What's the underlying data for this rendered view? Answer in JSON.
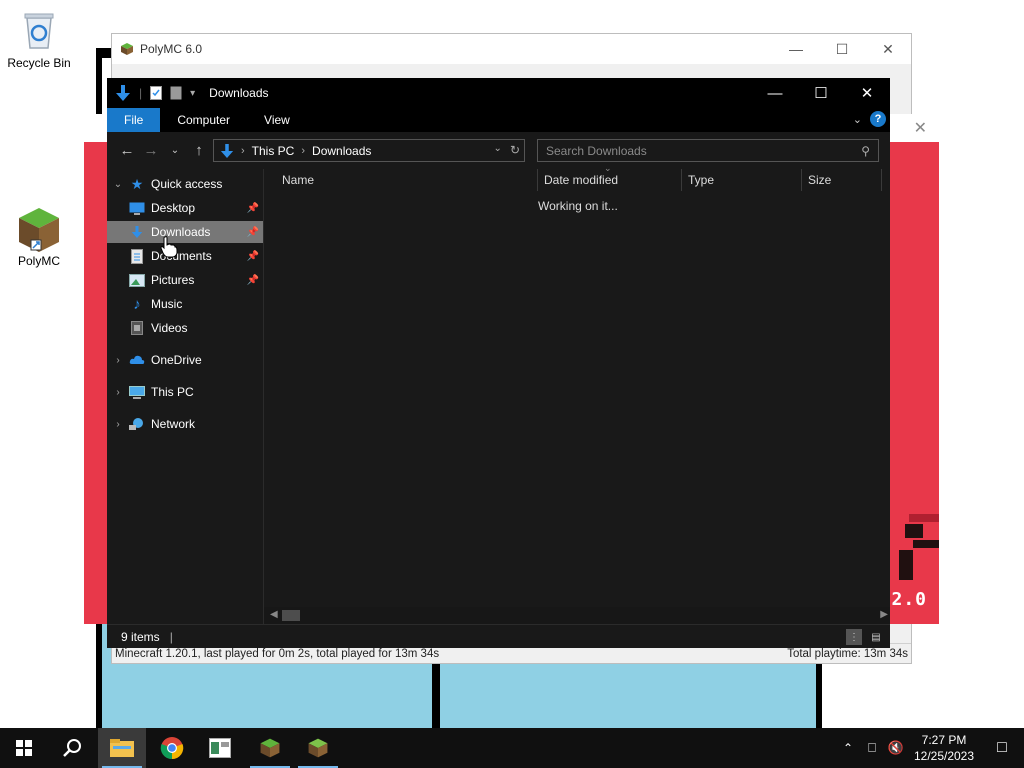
{
  "desktop": {
    "recycle_bin": "Recycle Bin",
    "polymc": "PolyMC"
  },
  "polymc_window": {
    "title": "PolyMC 6.0",
    "status_left": "Minecraft 1.20.1, last played for 0m 2s, total played for 13m 34s",
    "status_right": "Total playtime: 13m 34s"
  },
  "launcher_window": {
    "version_text": "2.0"
  },
  "explorer": {
    "title": "Downloads",
    "ribbon_tabs": [
      "File",
      "Computer",
      "View"
    ],
    "breadcrumb": [
      "This PC",
      "Downloads"
    ],
    "search_placeholder": "Search Downloads",
    "nav": {
      "quick_access": "Quick access",
      "desktop": "Desktop",
      "downloads": "Downloads",
      "documents": "Documents",
      "pictures": "Pictures",
      "music": "Music",
      "videos": "Videos",
      "onedrive": "OneDrive",
      "this_pc": "This PC",
      "network": "Network"
    },
    "columns": [
      "Name",
      "Date modified",
      "Type",
      "Size"
    ],
    "working_text": "Working on it...",
    "status_items": "9 items"
  },
  "taskbar": {
    "time": "7:27 PM",
    "date": "12/25/2023"
  },
  "colors": {
    "accent": "#1979ca",
    "launcher_red": "#e8384a",
    "explorer_bg": "#191919"
  }
}
